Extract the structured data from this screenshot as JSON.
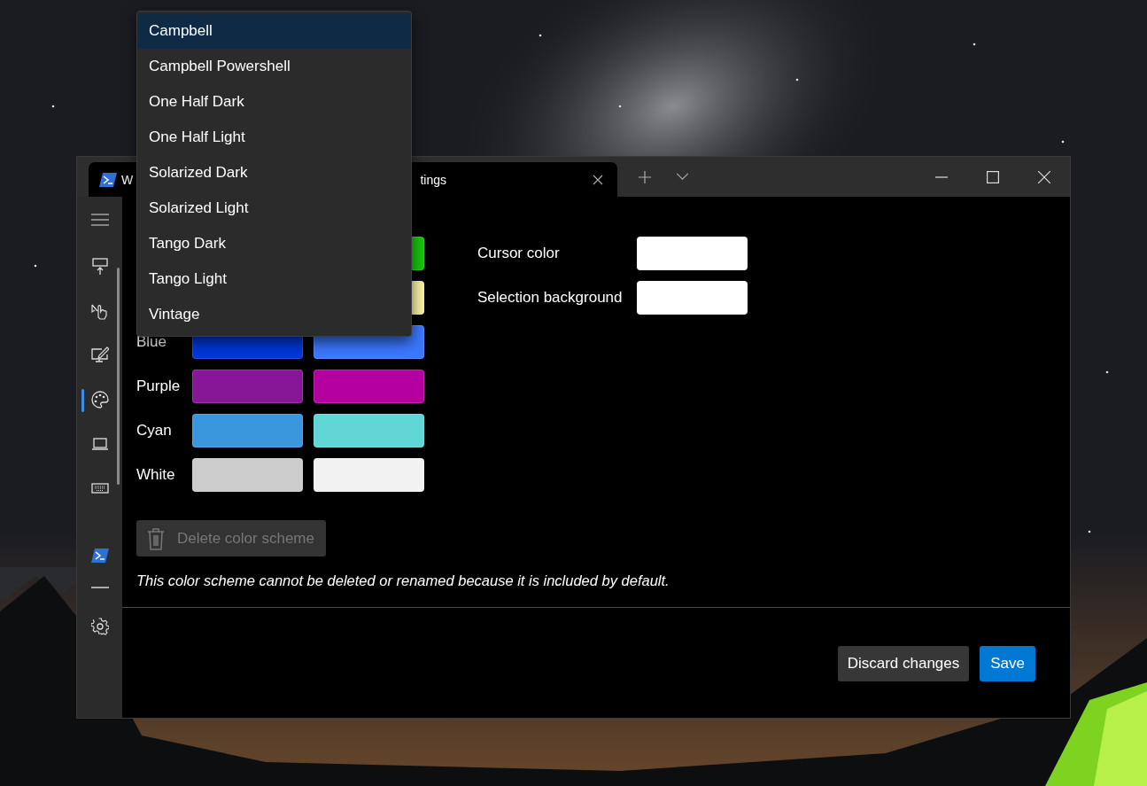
{
  "window": {
    "tab": {
      "title_start": "W",
      "title_end": "tings"
    }
  },
  "sidebar": {
    "items": [
      {
        "kind": "startup",
        "selected": false
      },
      {
        "kind": "interaction",
        "selected": false
      },
      {
        "kind": "appearance",
        "selected": false
      },
      {
        "kind": "color-schemes",
        "selected": true
      },
      {
        "kind": "rendering",
        "selected": false
      },
      {
        "kind": "actions",
        "selected": false
      },
      {
        "kind": "profile",
        "selected": false
      },
      {
        "kind": "divider",
        "selected": false
      },
      {
        "kind": "settings",
        "selected": false
      }
    ]
  },
  "colors": {
    "rows": [
      {
        "swatches": [
          {
            "kind": "bright",
            "color": "#16c60c"
          }
        ],
        "side": {
          "label": "Cursor color",
          "color": "#ffffff"
        }
      },
      {
        "swatches": [
          {
            "kind": "bright",
            "color": "#f9f1a5"
          }
        ],
        "side": {
          "label": "Selection background",
          "color": "#ffffff"
        }
      },
      {
        "label": "Blue",
        "swatches": [
          {
            "kind": "dark",
            "color": "#0037da"
          },
          {
            "kind": "bright",
            "color": "#3b78ff"
          }
        ]
      },
      {
        "label": "Purple",
        "swatches": [
          {
            "kind": "dark",
            "color": "#881798"
          },
          {
            "kind": "bright",
            "color": "#b4009e"
          }
        ]
      },
      {
        "label": "Cyan",
        "swatches": [
          {
            "kind": "dark",
            "color": "#3a96dd"
          },
          {
            "kind": "bright",
            "color": "#61d6d6"
          }
        ]
      },
      {
        "label": "White",
        "swatches": [
          {
            "kind": "dark",
            "color": "#cccccc"
          },
          {
            "kind": "bright",
            "color": "#f2f2f2"
          }
        ]
      }
    ]
  },
  "delete_button": {
    "label": "Delete color scheme",
    "disabled": true
  },
  "note": "This color scheme cannot be deleted or renamed because it is included by default.",
  "footer": {
    "buttons": [
      {
        "label": "Discard changes",
        "kind": "secondary"
      },
      {
        "label": "Save",
        "kind": "primary"
      }
    ]
  },
  "scheme_dropdown": {
    "options": [
      {
        "label": "Campbell",
        "selected": true
      },
      {
        "label": "Campbell Powershell",
        "selected": false
      },
      {
        "label": "One Half Dark",
        "selected": false
      },
      {
        "label": "One Half Light",
        "selected": false
      },
      {
        "label": "Solarized Dark",
        "selected": false
      },
      {
        "label": "Solarized Light",
        "selected": false
      },
      {
        "label": "Tango Dark",
        "selected": false
      },
      {
        "label": "Tango Light",
        "selected": false
      },
      {
        "label": "Vintage",
        "selected": false
      }
    ]
  }
}
